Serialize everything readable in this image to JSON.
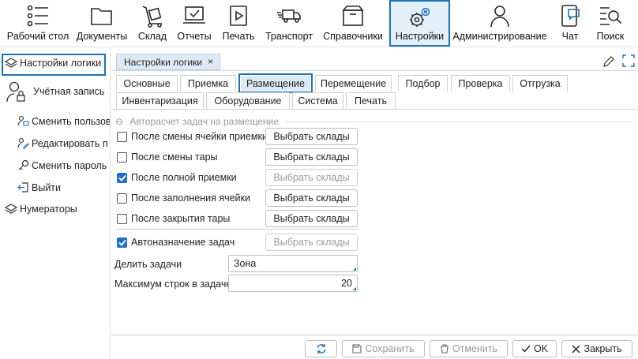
{
  "toolbar": {
    "items": [
      {
        "label": "Рабочий стол",
        "icon": "desktop-list-icon"
      },
      {
        "label": "Документы",
        "icon": "folder-icon"
      },
      {
        "label": "Склад",
        "icon": "cart-box-icon"
      },
      {
        "label": "Отчеты",
        "icon": "laptop-check-icon"
      },
      {
        "label": "Печать",
        "icon": "play-screen-icon"
      },
      {
        "label": "Транспорт",
        "icon": "truck-icon"
      },
      {
        "label": "Справочники",
        "icon": "box-archive-icon"
      },
      {
        "label": "Настройки",
        "icon": "gears-icon"
      },
      {
        "label": "Администрирование",
        "icon": "user-icon"
      },
      {
        "label": "Чат",
        "icon": "phone-chat-icon"
      },
      {
        "label": "Поиск",
        "icon": "search-list-icon"
      }
    ],
    "active": "Настройки"
  },
  "sidebar": {
    "items": [
      {
        "label": "Настройки логики"
      },
      {
        "label": "Учётная запись"
      },
      {
        "label": "Сменить пользов"
      },
      {
        "label": "Редактировать п"
      },
      {
        "label": "Сменить пароль"
      },
      {
        "label": "Выйти"
      },
      {
        "label": "Нумераторы"
      }
    ]
  },
  "doc_tab": {
    "label": "Настройки логики",
    "close": "×"
  },
  "tabs": {
    "row1": [
      "Основные",
      "Приемка",
      "Размещение",
      "Перемещение",
      "Подбор",
      "Проверка",
      "Отгрузка"
    ],
    "row2": [
      "Инвентаризация",
      "Оборудование",
      "Система",
      "Печать"
    ],
    "active": "Размещение"
  },
  "form": {
    "group_title": "Авторасчет задач на размещение",
    "group_toggle": "⊖",
    "checkboxes": [
      {
        "label": "После смены ячейки приемки",
        "checked": false,
        "button": "Выбрать склады",
        "button_enabled": true
      },
      {
        "label": "После смены тары",
        "checked": false,
        "button": "Выбрать склады",
        "button_enabled": true
      },
      {
        "label": "После полной приемки",
        "checked": true,
        "button": "Выбрать склады",
        "button_enabled": false
      },
      {
        "label": "После заполнения ячейки",
        "checked": false,
        "button": "Выбрать склады",
        "button_enabled": true
      },
      {
        "label": "После закрытия тары",
        "checked": false,
        "button": "Выбрать склады",
        "button_enabled": true
      }
    ],
    "auto_assign": {
      "label": "Автоназначение задач",
      "checked": true,
      "button": "Выбрать склады",
      "button_enabled": false
    },
    "split_tasks": {
      "label": "Делить задачи",
      "value": "Зона"
    },
    "max_rows": {
      "label": "Максимум строк в задаче",
      "value": "20"
    }
  },
  "footer": {
    "save": "Сохранить",
    "cancel": "Отменить",
    "ok": "OK",
    "close": "Закрыть"
  }
}
